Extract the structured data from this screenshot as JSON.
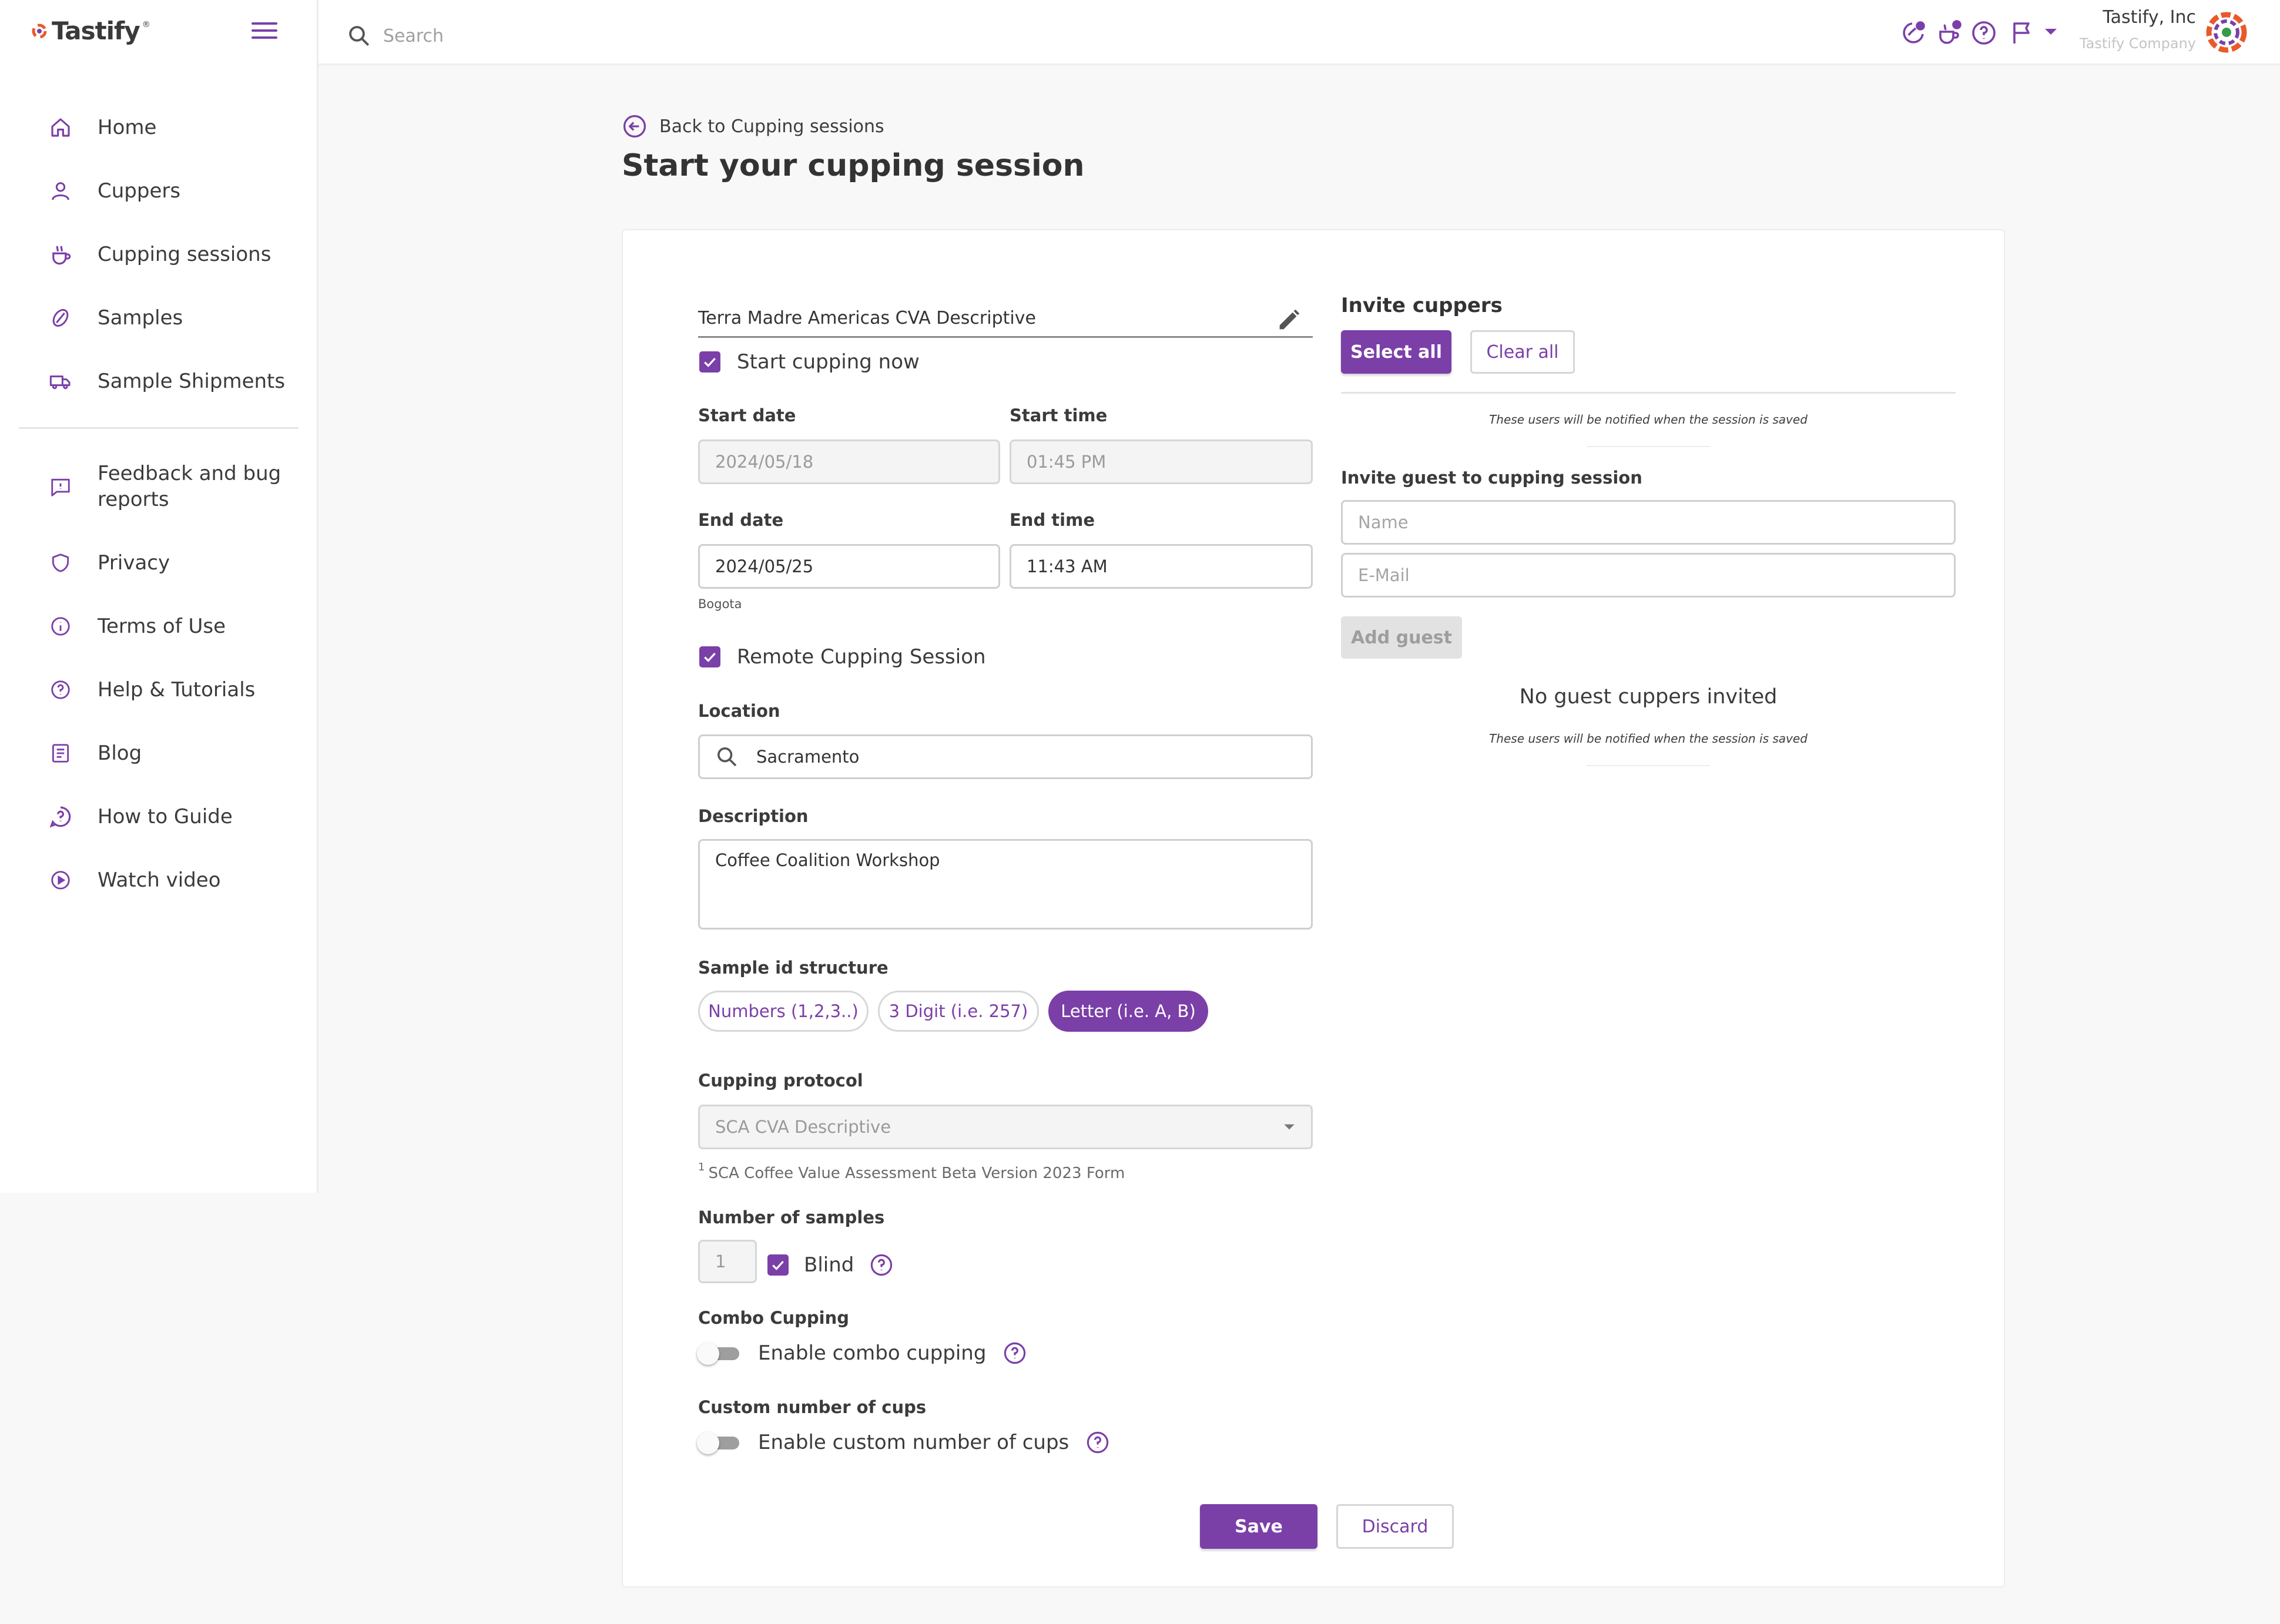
{
  "app": {
    "logo_text": "Tastify",
    "logo_tm": "®"
  },
  "topbar": {
    "search_placeholder": "Search",
    "icons": [
      "cuppers-notification-icon",
      "cupping-notification-icon",
      "help-icon",
      "flag-icon",
      "chevron-down-icon"
    ],
    "company": "Tastify, Inc",
    "company_sub": "Tastify Company"
  },
  "sidebar": {
    "items": [
      {
        "label": "Home",
        "icon": "home-icon"
      },
      {
        "label": "Cuppers",
        "icon": "user-icon"
      },
      {
        "label": "Cupping sessions",
        "icon": "cup-icon"
      },
      {
        "label": "Samples",
        "icon": "coffee-bean-icon"
      },
      {
        "label": "Sample Shipments",
        "icon": "truck-icon"
      },
      {
        "label": "Feedback and bug reports",
        "icon": "feedback-icon"
      },
      {
        "label": "Privacy",
        "icon": "shield-icon"
      },
      {
        "label": "Terms of Use",
        "icon": "info-icon"
      },
      {
        "label": "Help & Tutorials",
        "icon": "help-icon"
      },
      {
        "label": "Blog",
        "icon": "blog-icon"
      },
      {
        "label": "How to Guide",
        "icon": "guide-icon"
      },
      {
        "label": "Watch video",
        "icon": "play-icon"
      }
    ]
  },
  "header": {
    "back_label": "Back to Cupping sessions",
    "title": "Start your cupping session"
  },
  "form": {
    "session_name": "Terra Madre Americas CVA Descriptive",
    "start_now": {
      "label": "Start cupping now",
      "checked": true
    },
    "start_date": {
      "label": "Start date",
      "value": "2024/05/18"
    },
    "start_time": {
      "label": "Start time",
      "value": "01:45 PM"
    },
    "end_date": {
      "label": "End date",
      "value": "2024/05/25"
    },
    "end_time": {
      "label": "End time",
      "value": "11:43 AM"
    },
    "timezone": "Bogota",
    "remote": {
      "label": "Remote Cupping Session",
      "checked": true
    },
    "location": {
      "label": "Location",
      "value": "Sacramento"
    },
    "description": {
      "label": "Description",
      "value": "Coffee Coalition Workshop"
    },
    "sample_id": {
      "label": "Sample id structure",
      "options": [
        "Numbers (1,2,3..)",
        "3 Digit (i.e. 257)",
        "Letter (i.e. A, B)"
      ],
      "selected": "Letter (i.e. A, B)"
    },
    "protocol": {
      "label": "Cupping protocol",
      "value": "SCA CVA Descriptive",
      "footnote_mark": "1",
      "footnote": "SCA Coffee Value Assessment Beta Version 2023 Form"
    },
    "samples": {
      "label": "Number of samples",
      "value": "1",
      "blind_label": "Blind",
      "blind_checked": true
    },
    "combo": {
      "label": "Combo Cupping",
      "toggle_label": "Enable combo cupping",
      "enabled": false
    },
    "custom_cups": {
      "label": "Custom number of cups",
      "toggle_label": "Enable custom number of cups",
      "enabled": false
    },
    "save_label": "Save",
    "discard_label": "Discard"
  },
  "invite": {
    "title": "Invite cuppers",
    "select_all": "Select all",
    "clear_all": "Clear all",
    "notify_note": "These users will be notified when the session is saved",
    "guest_title": "Invite guest to cupping session",
    "name_placeholder": "Name",
    "email_placeholder": "E-Mail",
    "add_guest": "Add guest",
    "no_guests": "No guest cuppers invited",
    "guest_note": "These users will be notified when the session is saved"
  },
  "colors": {
    "accent": "#7b3fa8",
    "text": "#3d3d3d",
    "background": "#f8f8f9"
  }
}
